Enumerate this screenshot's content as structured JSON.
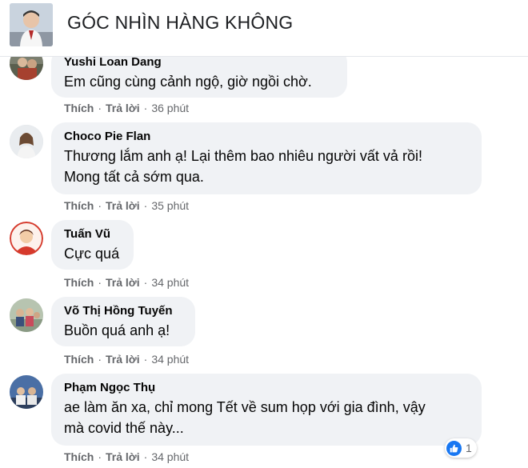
{
  "page": {
    "title": "GÓC NHÌN HÀNG KHÔNG"
  },
  "actions": {
    "like": "Thích",
    "reply": "Trả lời",
    "separator": "·"
  },
  "comments": [
    {
      "author": "Yushi Loan Dang",
      "lines": [
        "Em cũng cùng cảnh ngộ, giờ ngồi chờ."
      ],
      "time": "36 phút"
    },
    {
      "author": "Choco Pie Flan",
      "lines": [
        "Thương lắm anh ạ! Lại thêm bao nhiêu người vất vả rồi!",
        "Mong tất cả sớm qua."
      ],
      "time": "35 phút"
    },
    {
      "author": "Tuấn Vũ",
      "lines": [
        "Cực quá"
      ],
      "time": "34 phút"
    },
    {
      "author": "Võ Thị Hồng Tuyến",
      "lines": [
        "Buồn quá anh ạ!"
      ],
      "time": "34 phút"
    },
    {
      "author": "Phạm Ngọc Thụ",
      "lines": [
        "ae làm ăn xa, chỉ mong Tết về sum họp với gia đình, vậy",
        "mà covid thế này..."
      ],
      "time": "34 phút",
      "reactions": {
        "icon": "like-icon",
        "count": "1"
      }
    }
  ],
  "colors": {
    "bubble": "#f0f2f5",
    "meta": "#65676b",
    "like": "#1877f2"
  }
}
